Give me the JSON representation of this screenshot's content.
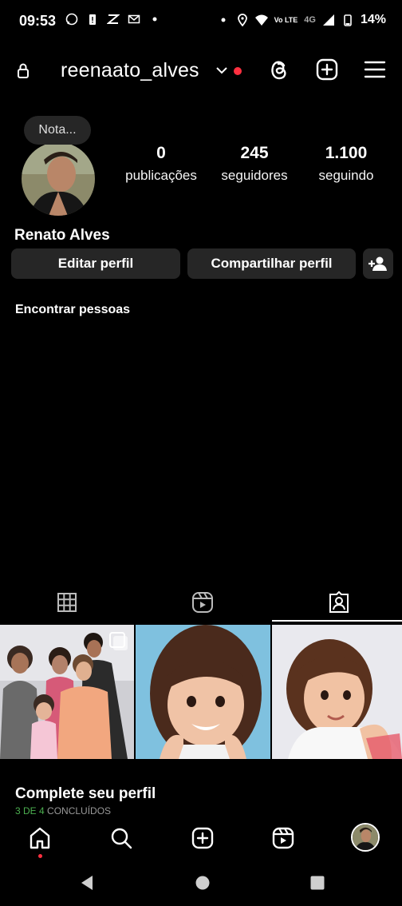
{
  "status_bar": {
    "time": "09:53",
    "battery": "14%",
    "network": "4G",
    "volte": "Vo LTE"
  },
  "header": {
    "username": "reenaato_alves",
    "icons": [
      "lock-icon",
      "chevron-down-icon",
      "threads-icon",
      "add-square-icon",
      "menu-icon"
    ]
  },
  "profile": {
    "note": "Nota...",
    "name": "Renato Alves",
    "stats": [
      {
        "value": "0",
        "label": "publicações"
      },
      {
        "value": "245",
        "label": "seguidores"
      },
      {
        "value": "1.100",
        "label": "seguindo"
      }
    ],
    "edit_button": "Editar perfil",
    "share_button": "Compartilhar perfil",
    "find_people": "Encontrar pessoas"
  },
  "tabs": [
    "grid-icon",
    "reels-icon",
    "tagged-icon"
  ],
  "complete": {
    "title": "Complete seu perfil",
    "progress": "3 DE 4",
    "progress_suffix": "CONCLUÍDOS",
    "completed_steps": 3,
    "total_steps": 4
  },
  "colors": {
    "background": "#000000",
    "button": "#262626",
    "notification": "#ff3040",
    "progress": "#4caf50"
  }
}
